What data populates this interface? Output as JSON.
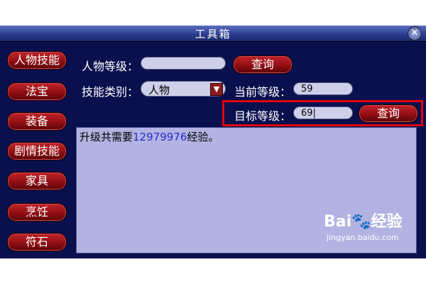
{
  "window": {
    "title": "工具箱",
    "close_symbol": "✕"
  },
  "sidebar": {
    "items": [
      {
        "label": "人物技能"
      },
      {
        "label": "法宝"
      },
      {
        "label": "装备"
      },
      {
        "label": "剧情技能"
      },
      {
        "label": "家具"
      },
      {
        "label": "烹饪"
      },
      {
        "label": "符石"
      }
    ]
  },
  "form": {
    "character_level_label": "人物等级：",
    "character_level_value": "",
    "query_button_label": "查询",
    "skill_type_label": "技能类别：",
    "skill_type_value": "人物",
    "current_level_label": "当前等级：",
    "current_level_value": "59",
    "target_level_label": "目标等级：",
    "target_level_value": "69|",
    "target_query_button_label": "查询"
  },
  "output": {
    "prefix": "升级共需要",
    "exp_value": "12979976",
    "suffix": "经验。"
  },
  "watermark": {
    "logo_text": "Bai🐾经验",
    "url_text": "jingyan.baidu.com"
  },
  "colors": {
    "window_bg": "#0a0f4e",
    "button_red": "#8b0d12",
    "field_bg": "#cdd0e8",
    "output_bg": "#b2b3e2",
    "highlight": "#e3000b",
    "exp_number": "#2a2ad0"
  }
}
